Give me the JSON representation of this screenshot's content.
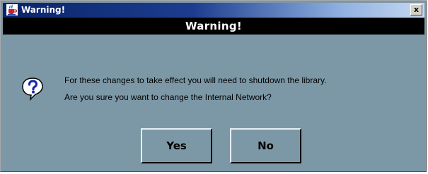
{
  "window": {
    "title": "Warning!"
  },
  "titlebar": {
    "close_glyph": "x"
  },
  "banner": {
    "text": "Warning!"
  },
  "message": {
    "line1": "For these changes to take effect you will need to shutdown the library.",
    "line2": "Are you sure you want to change the Internal Network?",
    "icon": "question-icon"
  },
  "buttons": {
    "yes_label": "Yes",
    "no_label": "No"
  },
  "colors": {
    "dialog_background": "#7c98a6",
    "titlebar_start": "#0a246a",
    "titlebar_end": "#c6d8f1",
    "banner_background": "#000000"
  }
}
